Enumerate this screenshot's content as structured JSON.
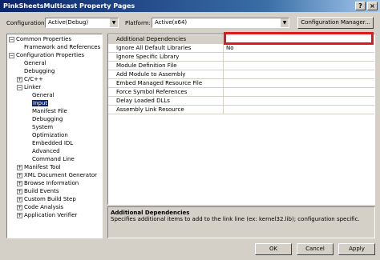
{
  "window": {
    "title": "PinkSheetsMulticast Property Pages",
    "help_glyph": "?",
    "close_glyph": "×"
  },
  "toolbar": {
    "configuration_label": "Configuration:",
    "configuration_value": "Active(Debug)",
    "platform_label": "Platform:",
    "platform_value": "Active(x64)",
    "config_manager_label": "Configuration Manager..."
  },
  "tree": {
    "items": [
      {
        "label": "Common Properties",
        "indent": 0,
        "expander": "−"
      },
      {
        "label": "Framework and References",
        "indent": 1,
        "expander": ""
      },
      {
        "label": "Configuration Properties",
        "indent": 0,
        "expander": "−"
      },
      {
        "label": "General",
        "indent": 1,
        "expander": ""
      },
      {
        "label": "Debugging",
        "indent": 1,
        "expander": ""
      },
      {
        "label": "C/C++",
        "indent": 1,
        "expander": "+"
      },
      {
        "label": "Linker",
        "indent": 1,
        "expander": "−"
      },
      {
        "label": "General",
        "indent": 2,
        "expander": ""
      },
      {
        "label": "Input",
        "indent": 2,
        "expander": "",
        "selected": true
      },
      {
        "label": "Manifest File",
        "indent": 2,
        "expander": ""
      },
      {
        "label": "Debugging",
        "indent": 2,
        "expander": ""
      },
      {
        "label": "System",
        "indent": 2,
        "expander": ""
      },
      {
        "label": "Optimization",
        "indent": 2,
        "expander": ""
      },
      {
        "label": "Embedded IDL",
        "indent": 2,
        "expander": ""
      },
      {
        "label": "Advanced",
        "indent": 2,
        "expander": ""
      },
      {
        "label": "Command Line",
        "indent": 2,
        "expander": ""
      },
      {
        "label": "Manifest Tool",
        "indent": 1,
        "expander": "+"
      },
      {
        "label": "XML Document Generator",
        "indent": 1,
        "expander": "+"
      },
      {
        "label": "Browse Information",
        "indent": 1,
        "expander": "+"
      },
      {
        "label": "Build Events",
        "indent": 1,
        "expander": "+"
      },
      {
        "label": "Custom Build Step",
        "indent": 1,
        "expander": "+"
      },
      {
        "label": "Code Analysis",
        "indent": 1,
        "expander": "+"
      },
      {
        "label": "Application Verifier",
        "indent": 1,
        "expander": "+"
      }
    ]
  },
  "grid": {
    "rows": [
      {
        "name": "Additional Dependencies",
        "value": ""
      },
      {
        "name": "Ignore All Default Libraries",
        "value": "No"
      },
      {
        "name": "Ignore Specific Library",
        "value": ""
      },
      {
        "name": "Module Definition File",
        "value": ""
      },
      {
        "name": "Add Module to Assembly",
        "value": ""
      },
      {
        "name": "Embed Managed Resource File",
        "value": ""
      },
      {
        "name": "Force Symbol References",
        "value": ""
      },
      {
        "name": "Delay Loaded DLLs",
        "value": ""
      },
      {
        "name": "Assembly Link Resource",
        "value": ""
      }
    ]
  },
  "description": {
    "title": "Additional Dependencies",
    "text": "Specifies additional items to add to the link line (ex: kernel32.lib); configuration specific."
  },
  "buttons": {
    "ok": "OK",
    "cancel": "Cancel",
    "apply": "Apply"
  },
  "colors": {
    "selection": "#0a246a",
    "highlight_box": "#e01a1a",
    "dialog": "#d4d0c8"
  }
}
